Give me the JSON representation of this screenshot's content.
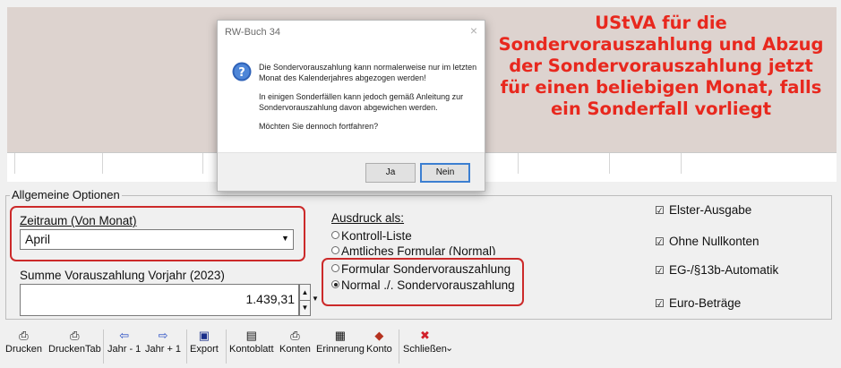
{
  "dialog": {
    "title": "RW-Buch 34",
    "close": "×",
    "paragraphs": [
      "Die Sondervorauszahlung kann normalerweise nur im letzten Monat des Kalenderjahres abgezogen werden!",
      "In einigen Sonderfällen kann jedoch gemäß Anleitung zur Sondervorauszahlung davon abgewichen werden.",
      "Möchten Sie dennoch fortfahren?"
    ],
    "yes_label": "Ja",
    "no_label": "Nein"
  },
  "annotation": {
    "lines": [
      "UStVA für die",
      "Sondervorauszahlung und Abzug",
      "der Sondervorauszahlung jetzt",
      "für einen beliebigen Monat, falls",
      "ein Sonderfall vorliegt"
    ],
    "color": "#e8281e"
  },
  "options": {
    "legend": "Allgemeine Optionen",
    "zeitraum_label": "Zeitraum (Von Monat)",
    "zeitraum_value": "April",
    "summe_label": "Summe Vorauszahlung Vorjahr (2023)",
    "summe_value": "1.439,31",
    "ausdruck_label": "Ausdruck als:",
    "radios": [
      {
        "label": "Kontroll-Liste",
        "selected": false
      },
      {
        "label": "Amtliches Formular (Normal)",
        "selected": false
      },
      {
        "label": "Formular Sondervorauszahlung",
        "selected": false
      },
      {
        "label": "Normal ./. Sondervorauszahlung",
        "selected": true
      }
    ],
    "checkboxes": [
      {
        "label": "Elster-Ausgabe",
        "checked": true
      },
      {
        "label": "Ohne Nullkonten",
        "checked": true
      },
      {
        "label": "EG-/§13b-Automatik",
        "checked": true
      },
      {
        "label": "Euro-Beträge",
        "checked": true
      }
    ],
    "highlight_color": "#cc2a2a"
  },
  "toolbar": {
    "drucken": "Drucken",
    "drucken_tab": "DruckenTab",
    "jahr_minus": "Jahr - 1",
    "jahr_plus": "Jahr + 1",
    "export": "Export",
    "kontoblatt": "Kontoblatt",
    "konten": "Konten",
    "erinnerung": "Erinnerung",
    "konto": "Konto",
    "schliessen": "Schließen"
  }
}
